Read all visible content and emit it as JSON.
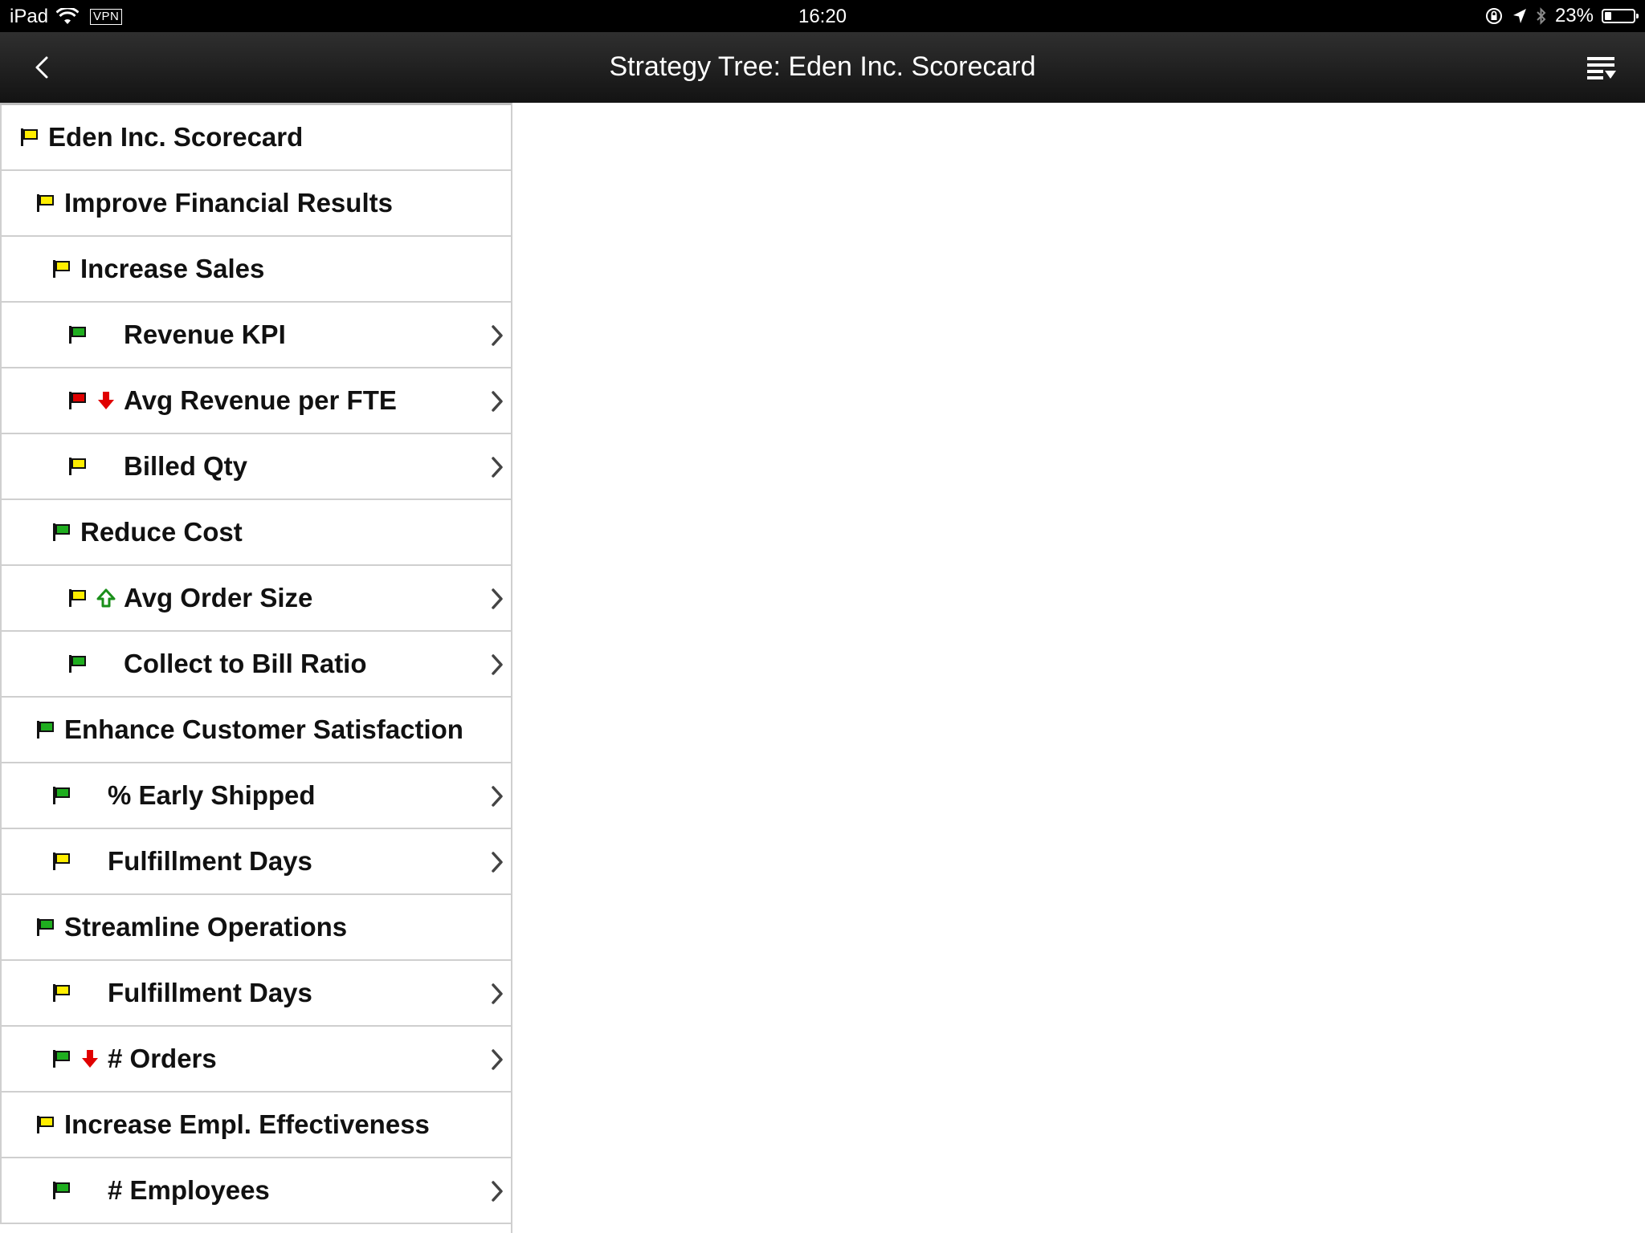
{
  "status_bar": {
    "device": "iPad",
    "vpn": "VPN",
    "time": "16:20",
    "battery_percent": "23%"
  },
  "nav": {
    "title": "Strategy Tree: Eden Inc. Scorecard"
  },
  "colors": {
    "flag_yellow": "#ffee00",
    "flag_green": "#1fae1f",
    "flag_red": "#e00000",
    "trend_down": "#e00000",
    "trend_up": "#1a8f1a"
  },
  "tree": [
    {
      "label": "Eden Inc. Scorecard",
      "level": 0,
      "status": "yellow",
      "trend": null,
      "drill": false
    },
    {
      "label": "Improve Financial Results",
      "level": 1,
      "status": "yellow",
      "trend": null,
      "drill": false
    },
    {
      "label": "Increase Sales",
      "level": 2,
      "status": "yellow",
      "trend": null,
      "drill": false
    },
    {
      "label": "Revenue KPI",
      "level": 3,
      "status": "green",
      "trend": null,
      "drill": true
    },
    {
      "label": "Avg Revenue per FTE",
      "level": 3,
      "status": "red",
      "trend": "down",
      "drill": true
    },
    {
      "label": "Billed Qty",
      "level": 3,
      "status": "yellow",
      "trend": null,
      "drill": true
    },
    {
      "label": "Reduce Cost",
      "level": 2,
      "status": "green",
      "trend": null,
      "drill": false
    },
    {
      "label": "Avg Order Size",
      "level": 3,
      "status": "yellow",
      "trend": "up",
      "drill": true
    },
    {
      "label": "Collect to Bill Ratio",
      "level": 3,
      "status": "green",
      "trend": null,
      "drill": true
    },
    {
      "label": "Enhance Customer Satisfaction",
      "level": 1,
      "status": "green",
      "trend": null,
      "drill": false
    },
    {
      "label": "% Early Shipped",
      "level": 2,
      "status": "green",
      "trend": null,
      "drill": true
    },
    {
      "label": "Fulfillment Days",
      "level": 2,
      "status": "yellow",
      "trend": null,
      "drill": true
    },
    {
      "label": "Streamline Operations",
      "level": 1,
      "status": "green",
      "trend": null,
      "drill": false
    },
    {
      "label": "Fulfillment Days",
      "level": 2,
      "status": "yellow",
      "trend": null,
      "drill": true
    },
    {
      "label": "# Orders",
      "level": 2,
      "status": "green",
      "trend": "down",
      "drill": true
    },
    {
      "label": "Increase Empl. Effectiveness",
      "level": 1,
      "status": "yellow",
      "trend": null,
      "drill": false
    },
    {
      "label": "# Employees",
      "level": 2,
      "status": "green",
      "trend": null,
      "drill": true
    }
  ]
}
